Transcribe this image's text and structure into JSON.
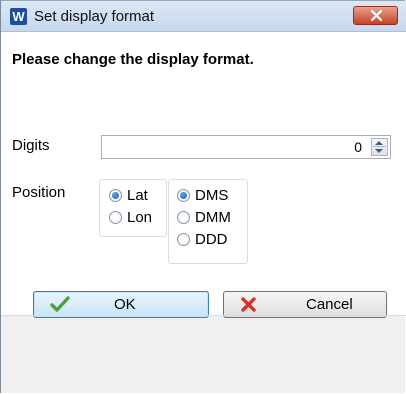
{
  "window": {
    "title": "Set display format",
    "app_icon_letter": "W"
  },
  "form": {
    "heading": "Please change the display format.",
    "digits_label": "Digits",
    "digits_value": "0",
    "position_label": "Position",
    "axis_options": [
      {
        "label": "Lat",
        "checked": true
      },
      {
        "label": "Lon",
        "checked": false
      }
    ],
    "format_options": [
      {
        "label": "DMS",
        "checked": true
      },
      {
        "label": "DMM",
        "checked": false
      },
      {
        "label": "DDD",
        "checked": false
      }
    ]
  },
  "buttons": {
    "ok_label": "OK",
    "cancel_label": "Cancel"
  },
  "colors": {
    "title_bar": "#c7d8ee",
    "close_button": "#c9412a",
    "ok_check": "#4aa23a",
    "cancel_x": "#d0342c",
    "radio_dot": "#1b5fb8"
  },
  "icons": {
    "app": "app-logo-icon",
    "close": "close-icon",
    "ok": "check-icon",
    "cancel": "x-icon",
    "spin_up": "chevron-up-icon",
    "spin_down": "chevron-down-icon"
  }
}
